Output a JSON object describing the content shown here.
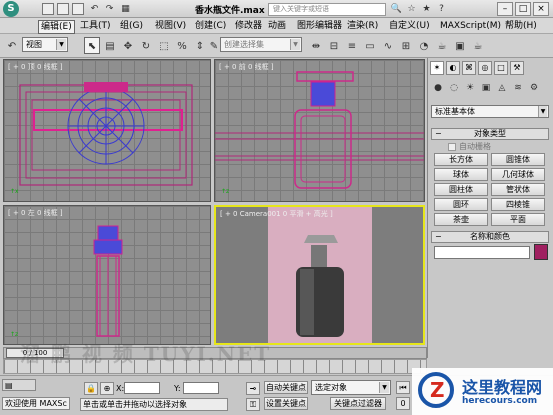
{
  "title": {
    "doc": "香水瓶文件.max",
    "search_placeholder": "键入关键字或短语"
  },
  "menu": [
    {
      "label": "编辑(E)"
    },
    {
      "label": "工具(T)"
    },
    {
      "label": "组(G)"
    },
    {
      "label": "视图(V)"
    },
    {
      "label": "创建(C)"
    },
    {
      "label": "修改器"
    },
    {
      "label": "动画"
    },
    {
      "label": "图形编辑器"
    },
    {
      "label": "渲染(R)"
    },
    {
      "label": "自定义(U)"
    },
    {
      "label": "MAXScript(M)"
    },
    {
      "label": "帮助(H)"
    }
  ],
  "toolbar": {
    "view_dropdown": "视图",
    "selection_set_placeholder": "创建选择集"
  },
  "viewports": {
    "top": "[ + 0 顶 0 线框 ]",
    "front": "[ + 0 前 0 线框 ]",
    "left": "[ + 0 左 0 线框 ]",
    "camera": "[ + 0 Camera001 0 平滑 + 高光 ]"
  },
  "panel": {
    "category_dropdown": "标准基本体",
    "object_type_title": "对象类型",
    "autogrid_label": "自动栅格",
    "buttons": [
      "长方体",
      "圆锥体",
      "球体",
      "几何球体",
      "圆柱体",
      "管状体",
      "圆环",
      "四棱锥",
      "茶壶",
      "平面"
    ],
    "name_color_title": "名称和颜色",
    "object_color": "#a02060"
  },
  "timeline": {
    "frame_display": "0 / 100"
  },
  "status": {
    "welcome": "欢迎使用 MAXSc",
    "prompt": "单击或单击并拖动以选择对象",
    "x_label": "X:",
    "y_label": "Y:",
    "auto_key": "自动关键点",
    "set_key": "设置关键点",
    "selected_object": "选定对象",
    "key_filters": "关键点过滤器",
    "frame_field": "0"
  },
  "watermark": {
    "site_name": "这里教程网",
    "site_url": "herecours.com",
    "overlay": "溜 鹏 视 频 TUYI.NET"
  }
}
